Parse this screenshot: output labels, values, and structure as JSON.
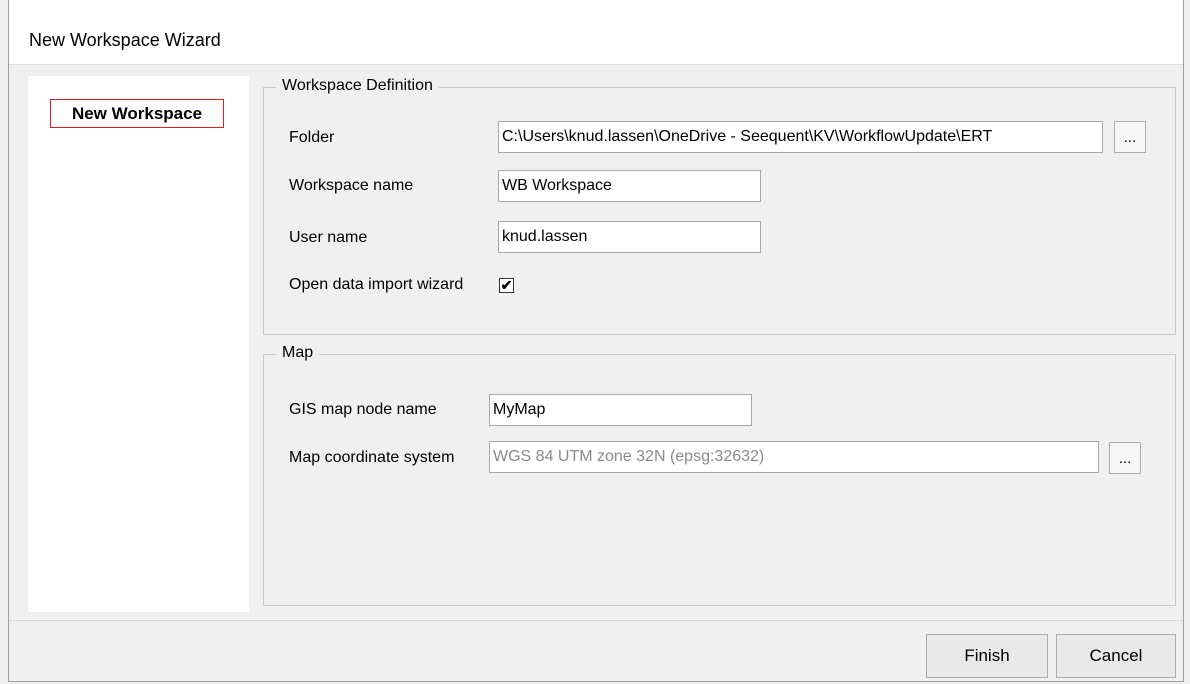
{
  "window": {
    "title": "New Workspace Wizard"
  },
  "sidebar": {
    "steps": [
      {
        "label": "New Workspace"
      }
    ]
  },
  "workspace_definition": {
    "legend": "Workspace Definition",
    "folder_label": "Folder",
    "folder_value": "C:\\Users\\knud.lassen\\OneDrive - Seequent\\KV\\WorkflowUpdate\\ERT",
    "browse_label": "...",
    "workspace_name_label": "Workspace name",
    "workspace_name_value": "WB Workspace",
    "user_name_label": "User name",
    "user_name_value": "knud.lassen",
    "open_import_label": "Open data import wizard",
    "open_import_checked": true,
    "check_glyph": "✔"
  },
  "map": {
    "legend": "Map",
    "gis_node_label": "GIS map node name",
    "gis_node_value": "MyMap",
    "coord_label": "Map coordinate system",
    "coord_value": "WGS 84 UTM zone 32N (epsg:32632)",
    "browse_label": "..."
  },
  "buttons": {
    "finish": "Finish",
    "cancel": "Cancel"
  }
}
